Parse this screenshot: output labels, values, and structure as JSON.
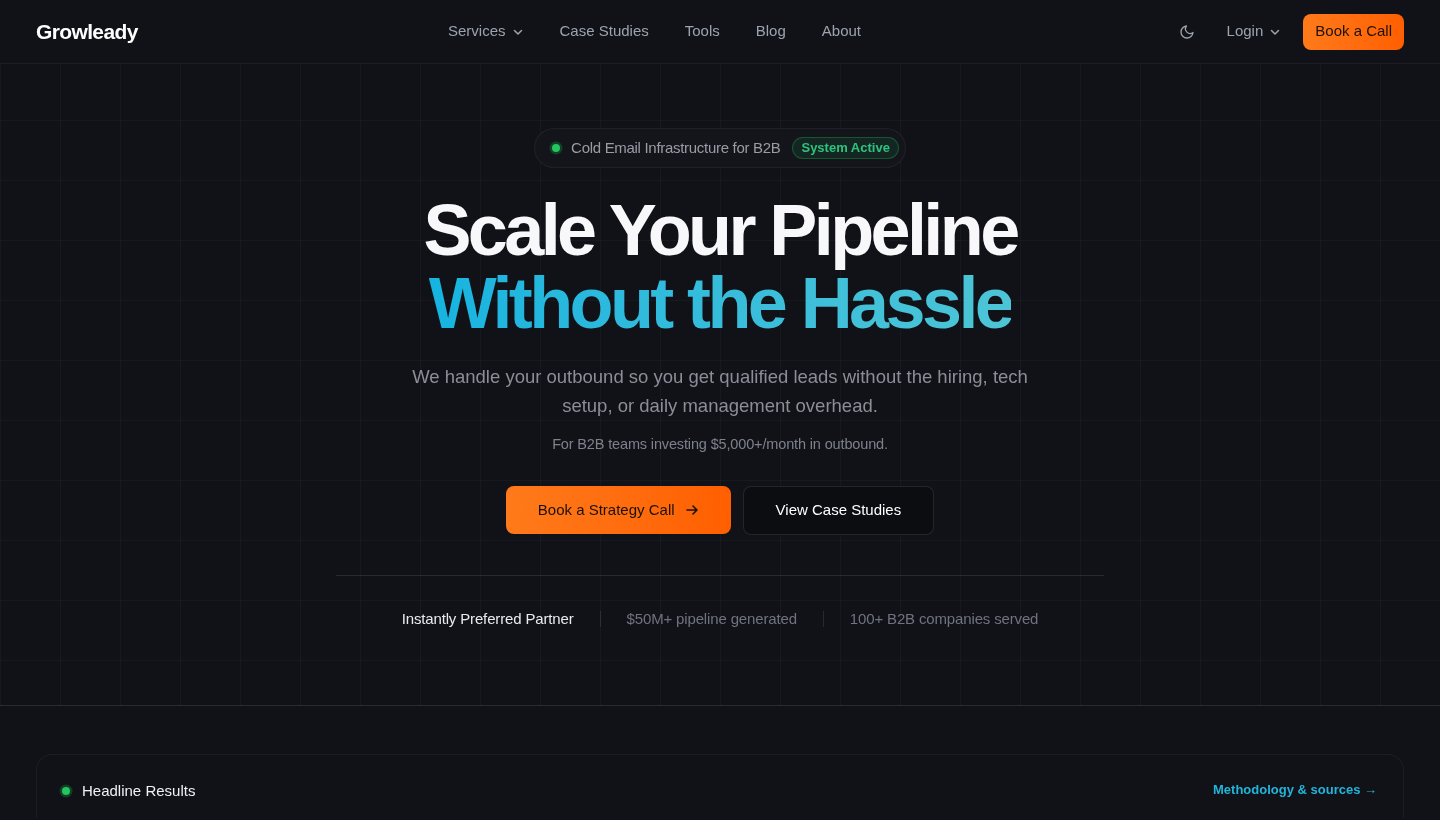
{
  "nav": {
    "logo": "Growleady",
    "links": [
      {
        "label": "Services",
        "has_menu": true
      },
      {
        "label": "Case Studies",
        "has_menu": false
      },
      {
        "label": "Tools",
        "has_menu": false
      },
      {
        "label": "Blog",
        "has_menu": false
      },
      {
        "label": "About",
        "has_menu": false
      }
    ],
    "login": {
      "label": "Login",
      "has_menu": true
    },
    "cta": "Book a Call"
  },
  "hero": {
    "badge": {
      "text": "Cold Email Infrastructure for B2B",
      "status": "System Active"
    },
    "headline": "Scale Your Pipeline",
    "headline_accent": "Without the Hassle",
    "subtitle": "We handle your outbound so you get qualified leads without the hiring, tech setup, or daily management overhead.",
    "note": "For B2B teams investing $5,000+/month in outbound.",
    "buttons": [
      {
        "label": "Book a Strategy Call",
        "kind": "primary"
      },
      {
        "label": "View Case Studies",
        "kind": "secondary"
      }
    ]
  },
  "proof": [
    {
      "text": "Instantly Preferred Partner",
      "emphasis": true
    },
    {
      "text": "$50M+ pipeline generated",
      "emphasis": false
    },
    {
      "text": "100+ B2B companies served",
      "emphasis": false
    }
  ],
  "results": {
    "title": "Headline Results",
    "link": "Methodology & sources →"
  }
}
